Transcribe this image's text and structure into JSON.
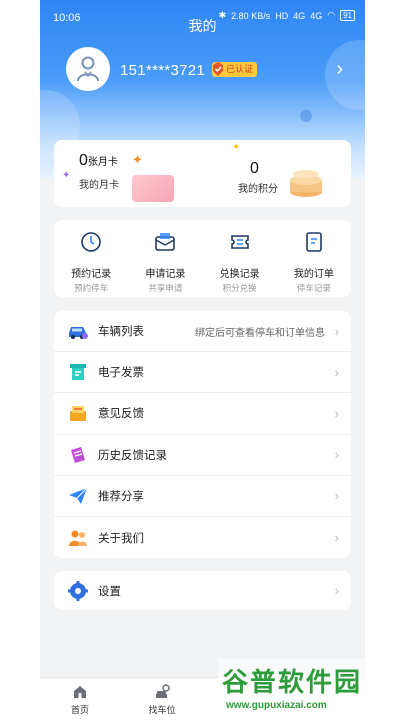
{
  "status_bar": {
    "time": "10:06",
    "speed": "2.80",
    "speed_unit": "KB/s",
    "network_1": "HD",
    "network_2": "4G",
    "network_3": "4G",
    "battery": "91"
  },
  "header": {
    "title": "我的",
    "phone": "151****3721",
    "verified_label": "已认证"
  },
  "stats": {
    "month_card_count": "0",
    "month_card_unit": "张月卡",
    "month_card_label": "我的月卡",
    "points_value": "0",
    "points_label": "我的积分"
  },
  "shortcuts": [
    {
      "title": "预约记录",
      "subtitle": "预约停车",
      "icon": "clock-icon"
    },
    {
      "title": "申请记录",
      "subtitle": "共享申请",
      "icon": "envelope-icon"
    },
    {
      "title": "兑换记录",
      "subtitle": "积分兑换",
      "icon": "ticket-icon"
    },
    {
      "title": "我的订单",
      "subtitle": "停车记录",
      "icon": "document-icon"
    }
  ],
  "menu": [
    {
      "label": "车辆列表",
      "hint": "绑定后可查看停车和订单信息",
      "icon": "car-icon"
    },
    {
      "label": "电子发票",
      "hint": "",
      "icon": "invoice-icon"
    },
    {
      "label": "意见反馈",
      "hint": "",
      "icon": "feedback-icon"
    },
    {
      "label": "历史反馈记录",
      "hint": "",
      "icon": "history-icon"
    },
    {
      "label": "推荐分享",
      "hint": "",
      "icon": "paper-plane-icon"
    },
    {
      "label": "关于我们",
      "hint": "",
      "icon": "people-icon"
    }
  ],
  "settings": {
    "label": "设置",
    "icon": "gear-icon"
  },
  "tabbar": [
    {
      "label": "首页",
      "icon": "home-icon"
    },
    {
      "label": "找车位",
      "icon": "parking-search-icon"
    }
  ],
  "watermark": {
    "text": "谷普软件园",
    "url": "www.gupuxiazai.com"
  },
  "colors": {
    "primary": "#2f86f6",
    "badge": "#ffc93d",
    "accent": "#f58a2a"
  }
}
